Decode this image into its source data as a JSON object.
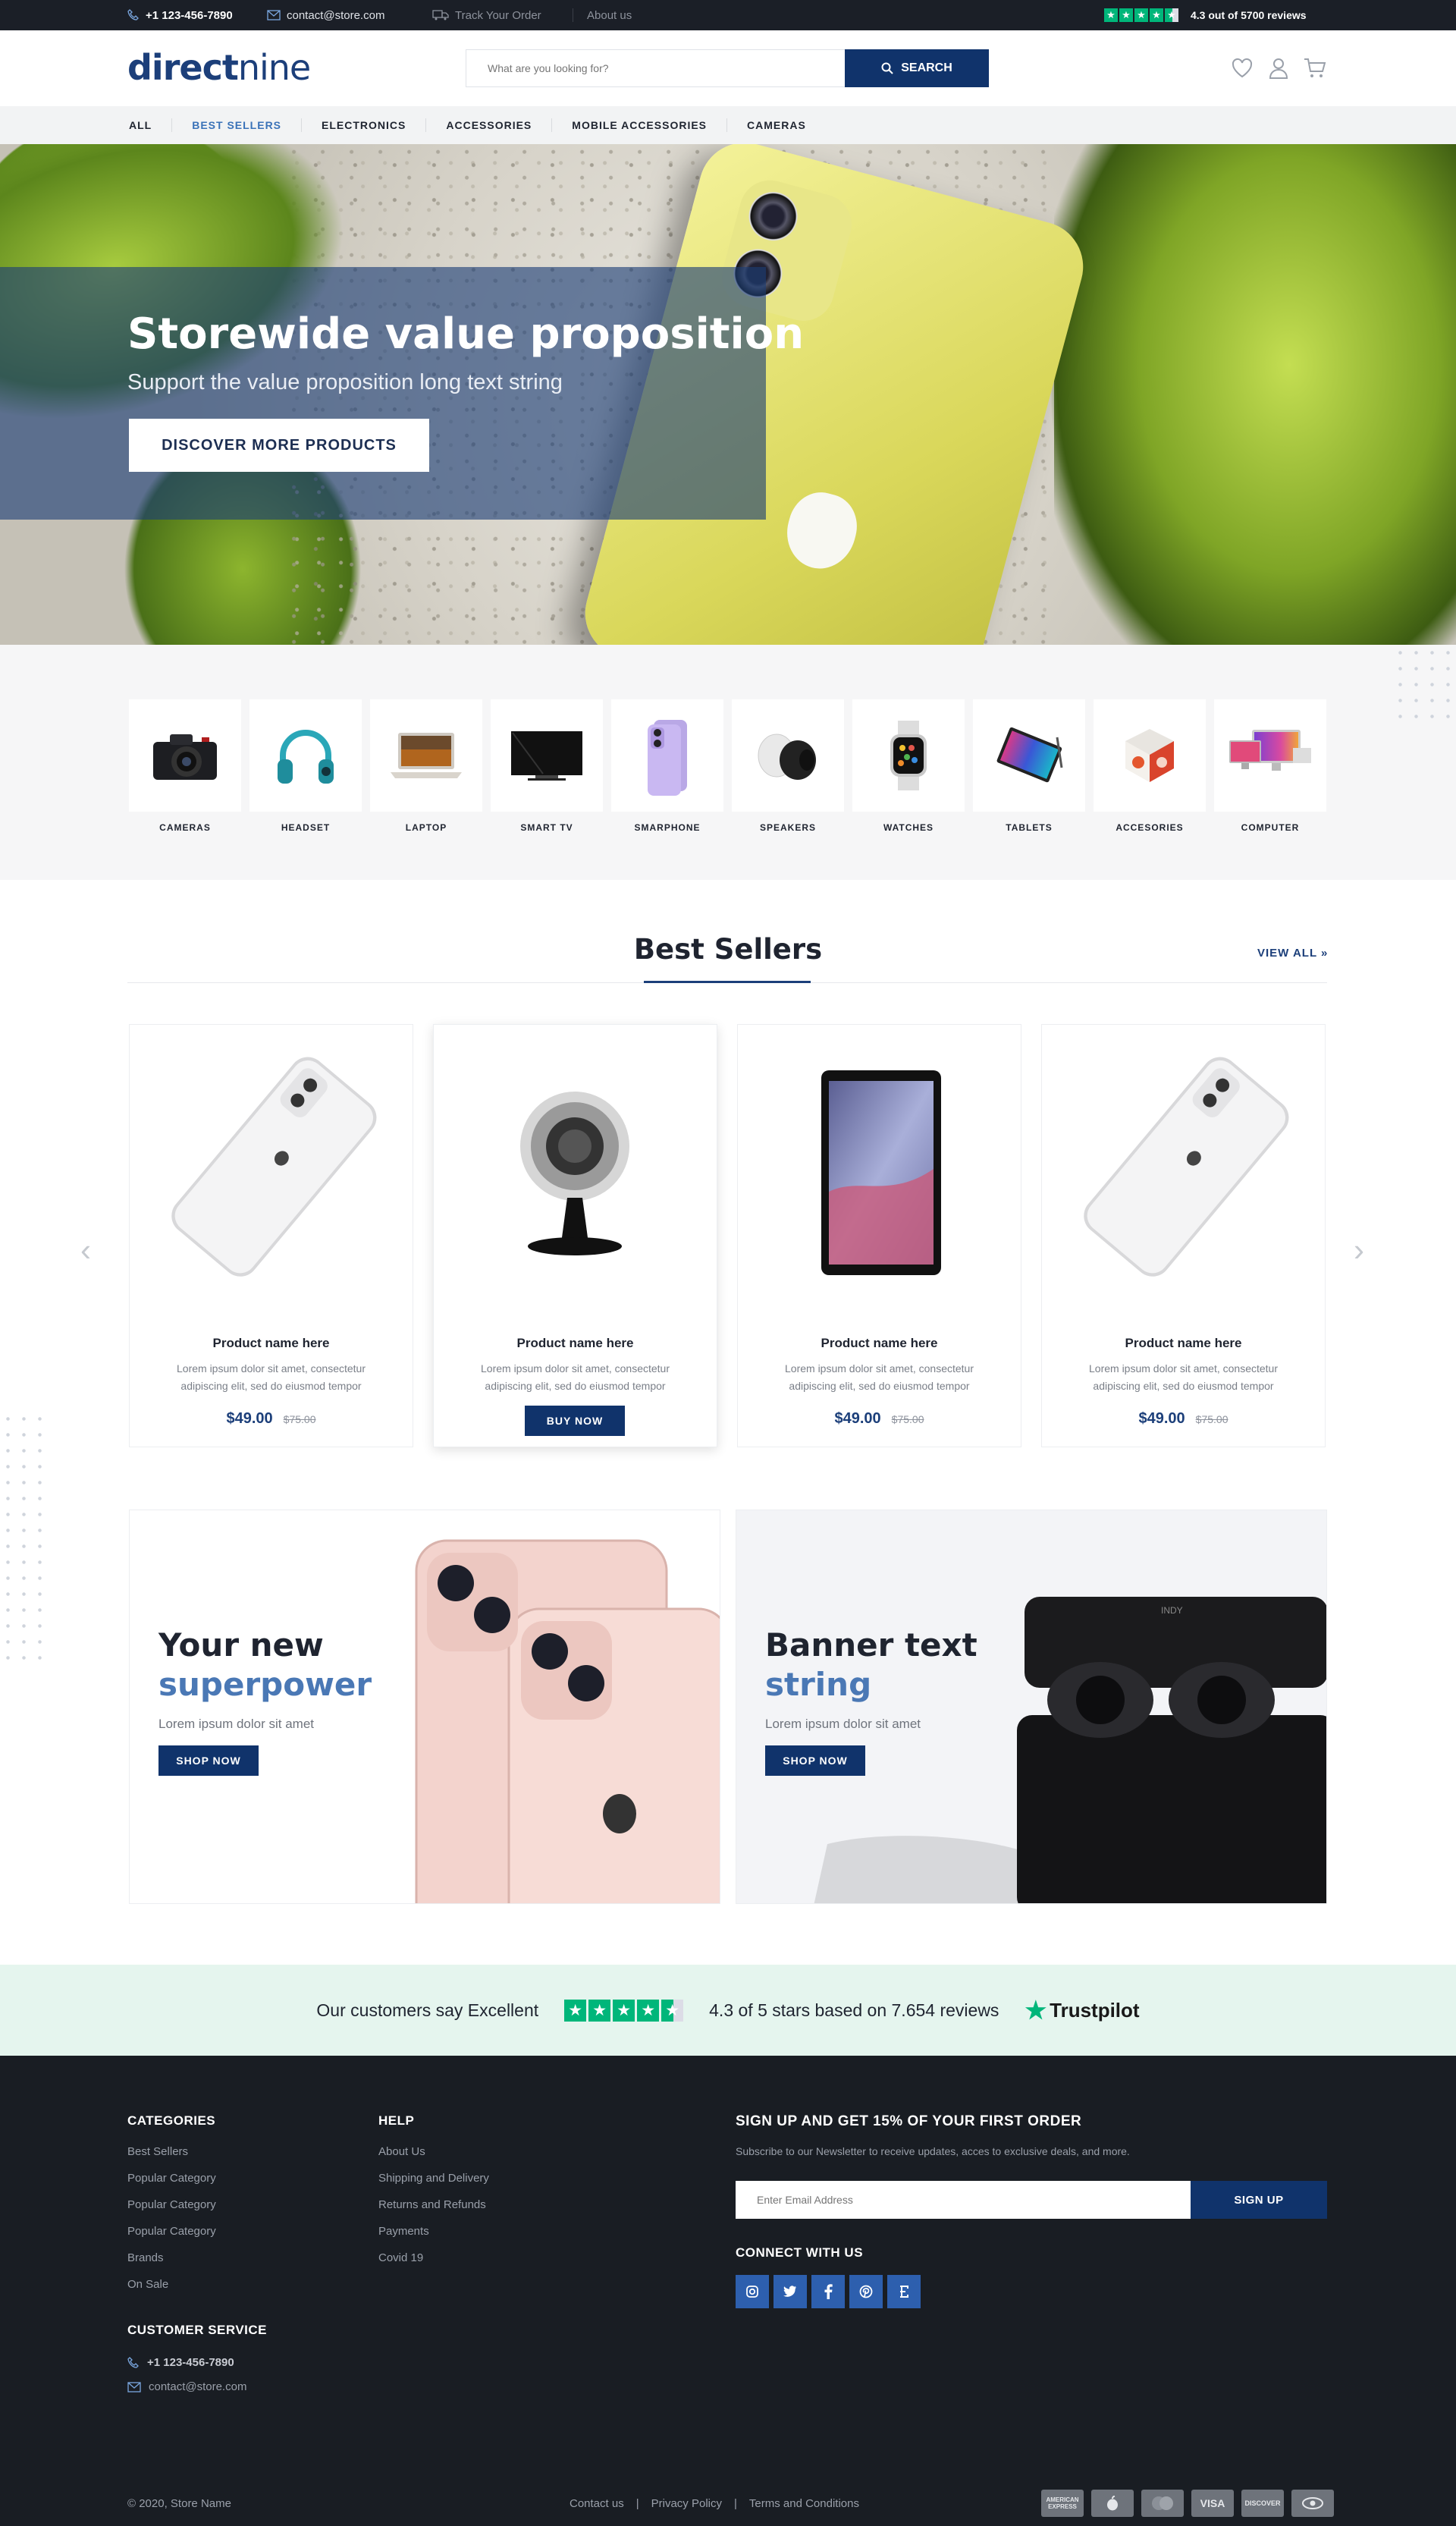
{
  "topbar": {
    "phone": "+1 123-456-7890",
    "email": "contact@store.com",
    "track": "Track Your Order",
    "about": "About us",
    "rating_text": "4.3 out of",
    "reviews_text": "5700 reviews"
  },
  "header": {
    "logo_bold": "direct",
    "logo_light": "nine",
    "search_placeholder": "What are you looking for?",
    "search_button": "SEARCH"
  },
  "nav": {
    "items": [
      "ALL",
      "BEST SELLERS",
      "ELECTRONICS",
      "ACCESSORIES",
      "MOBILE ACCESSORIES",
      "CAMERAS"
    ],
    "active": "BEST SELLERS"
  },
  "hero": {
    "title": "Storewide value proposition",
    "subtitle": "Support the value proposition long text string",
    "button": "DISCOVER MORE PRODUCTS"
  },
  "categories": [
    "CAMERAS",
    "HEADSET",
    "LAPTOP",
    "SMART TV",
    "SMARPHONE",
    "SPEAKERS",
    "WATCHES",
    "TABLETS",
    "ACCESORIES",
    "COMPUTER"
  ],
  "best_sellers": {
    "title": "Best Sellers",
    "view_all": "VIEW ALL",
    "products": [
      {
        "name": "Product name here",
        "desc": "Lorem ipsum dolor sit amet, consectetur adipiscing elit, sed do eiusmod tempor",
        "price": "$49.00",
        "old_price": "$75.00"
      },
      {
        "name": "Product name here",
        "desc": "Lorem ipsum dolor sit amet, consectetur adipiscing elit, sed do eiusmod tempor",
        "buy": "BUY NOW"
      },
      {
        "name": "Product name here",
        "desc": "Lorem ipsum dolor sit amet, consectetur adipiscing elit, sed do eiusmod tempor",
        "price": "$49.00",
        "old_price": "$75.00"
      },
      {
        "name": "Product name here",
        "desc": "Lorem ipsum dolor sit amet, consectetur adipiscing elit, sed do eiusmod tempor",
        "price": "$49.00",
        "old_price": "$75.00"
      }
    ]
  },
  "promos": [
    {
      "line1": "Your new",
      "line2": "superpower",
      "text": "Lorem ipsum dolor sit amet",
      "button": "SHOP NOW"
    },
    {
      "line1": "Banner text",
      "line2": "string",
      "text": "Lorem ipsum dolor sit amet",
      "button": "SHOP NOW",
      "case_brand": "INDY"
    }
  ],
  "trust": {
    "say": "Our customers say Excellent",
    "stars_text": "4.3 of 5 stars based on 7.654 reviews",
    "brand": "Trustpilot"
  },
  "footer": {
    "categories_title": "CATEGORIES",
    "categories": [
      "Best Sellers",
      "Popular Category",
      "Popular Category",
      "Popular Category",
      "Brands",
      "On Sale"
    ],
    "help_title": "HELP",
    "help": [
      "About Us",
      "Shipping and Delivery",
      "Returns and Refunds",
      "Payments",
      "Covid 19"
    ],
    "service_title": "CUSTOMER SERVICE",
    "phone": "+1 123-456-7890",
    "email": "contact@store.com",
    "signup_title": "SIGN UP AND GET 15% OF YOUR FIRST ORDER",
    "signup_text": "Subscribe to our Newsletter to receive updates, acces to exclusive deals, and more.",
    "email_placeholder": "Enter Email Address",
    "signup_button": "SIGN UP",
    "connect_title": "CONNECT WITH US",
    "copyright": "© 2020, Store Name",
    "links": [
      "Contact us",
      "Privacy Policy",
      "Terms and Conditions"
    ],
    "payments": [
      "AMERICAN EXPRESS",
      "",
      "",
      "VISA",
      "DISCOVER",
      ""
    ]
  },
  "colors": {
    "brand": "#10336b",
    "accent": "#4a78b5",
    "trustpilot": "#00b67a",
    "footer": "#191d23"
  },
  "icons": [
    "phone-icon",
    "mail-icon",
    "truck-icon",
    "heart-icon",
    "user-icon",
    "cart-icon",
    "search-icon",
    "instagram-icon",
    "twitter-icon",
    "facebook-icon",
    "pinterest-icon",
    "etsy-icon"
  ]
}
